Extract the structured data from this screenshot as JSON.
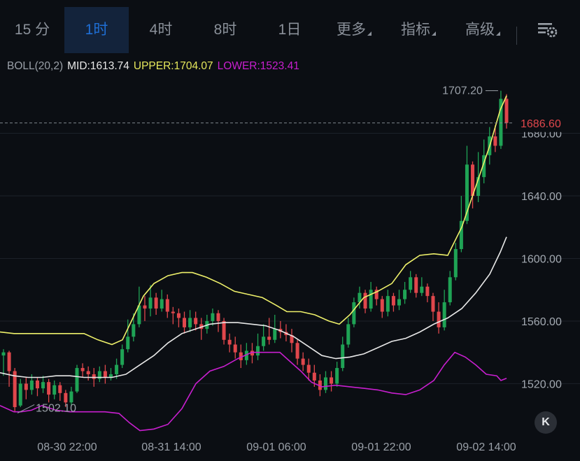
{
  "tabs": [
    {
      "label": "15 分",
      "active": false
    },
    {
      "label": "1时",
      "active": true
    },
    {
      "label": "4时",
      "active": false
    },
    {
      "label": "8时",
      "active": false
    },
    {
      "label": "1日",
      "active": false
    },
    {
      "label": "更多",
      "active": false,
      "dropdown": true
    },
    {
      "label": "指标",
      "active": false,
      "dropdown": true
    },
    {
      "label": "高级",
      "active": false,
      "dropdown": true
    }
  ],
  "settings_icon": "chart-settings-icon",
  "indicator": {
    "name": "BOLL(20,2)",
    "mid_label": "MID:",
    "mid_value": "1613.74",
    "upper_label": "UPPER:",
    "upper_value": "1704.07",
    "lower_label": "LOWER:",
    "lower_value": "1523.41"
  },
  "colors": {
    "up": "#1fa355",
    "down": "#e0474c",
    "mid": "#e8e8e8",
    "upper": "#eef06a",
    "lower": "#c81fcf",
    "active_tab": "#1f6fd6",
    "price_tag": "#e0474c"
  },
  "chart_data": {
    "type": "candlestick",
    "interval": "1h",
    "ylim": [
      1488,
      1716
    ],
    "y_ticks": [
      "1520.00",
      "1560.00",
      "1600.00",
      "1640.00",
      "1680.00"
    ],
    "x_ticks": [
      "08-30 22:00",
      "08-31 14:00",
      "09-01 06:00",
      "09-01 22:00",
      "09-02 14:00"
    ],
    "high_label": "1707.20",
    "low_label": "1502.10",
    "current_price": "1686.60",
    "candles": [
      [
        1538,
        1540,
        1542,
        1525
      ],
      [
        1540,
        1528,
        1541,
        1518
      ],
      [
        1528,
        1505,
        1530,
        1502.1
      ],
      [
        1506,
        1520,
        1523,
        1505
      ],
      [
        1520,
        1516,
        1524,
        1510
      ],
      [
        1516,
        1522,
        1526,
        1513
      ],
      [
        1522,
        1517,
        1524,
        1512
      ],
      [
        1517,
        1521,
        1525,
        1514
      ],
      [
        1521,
        1513,
        1523,
        1508
      ],
      [
        1513,
        1519,
        1522,
        1510
      ],
      [
        1519,
        1514,
        1521,
        1509
      ],
      [
        1514,
        1508,
        1516,
        1505
      ],
      [
        1508,
        1515,
        1518,
        1506
      ],
      [
        1515,
        1530,
        1532,
        1514
      ],
      [
        1530,
        1528,
        1533,
        1524
      ],
      [
        1528,
        1526,
        1531,
        1522
      ],
      [
        1526,
        1523,
        1530,
        1518
      ],
      [
        1523,
        1528,
        1531,
        1521
      ],
      [
        1528,
        1524,
        1532,
        1520
      ],
      [
        1524,
        1526,
        1530,
        1522
      ],
      [
        1526,
        1532,
        1536,
        1523
      ],
      [
        1532,
        1542,
        1545,
        1530
      ],
      [
        1542,
        1550,
        1561,
        1540
      ],
      [
        1550,
        1558,
        1565,
        1547
      ],
      [
        1558,
        1570,
        1582,
        1556
      ],
      [
        1570,
        1568,
        1576,
        1560
      ],
      [
        1568,
        1575,
        1583,
        1563
      ],
      [
        1575,
        1568,
        1578,
        1564
      ],
      [
        1568,
        1574,
        1580,
        1566
      ],
      [
        1574,
        1566,
        1577,
        1562
      ],
      [
        1566,
        1565,
        1569,
        1558
      ],
      [
        1565,
        1562,
        1568,
        1556
      ],
      [
        1562,
        1556,
        1566,
        1552
      ],
      [
        1556,
        1562,
        1567,
        1553
      ],
      [
        1562,
        1558,
        1566,
        1554
      ],
      [
        1558,
        1555,
        1562,
        1548
      ],
      [
        1555,
        1560,
        1564,
        1552
      ],
      [
        1560,
        1565,
        1568,
        1557
      ],
      [
        1565,
        1560,
        1567,
        1553
      ],
      [
        1560,
        1548,
        1562,
        1545
      ],
      [
        1548,
        1545,
        1552,
        1540
      ],
      [
        1545,
        1540,
        1550,
        1536
      ],
      [
        1540,
        1535,
        1545,
        1530
      ],
      [
        1535,
        1541,
        1546,
        1532
      ],
      [
        1541,
        1538,
        1546,
        1533
      ],
      [
        1538,
        1544,
        1552,
        1535
      ],
      [
        1544,
        1550,
        1558,
        1541
      ],
      [
        1550,
        1548,
        1562,
        1545
      ],
      [
        1548,
        1555,
        1564,
        1546
      ],
      [
        1555,
        1553,
        1560,
        1549
      ],
      [
        1553,
        1551,
        1558,
        1547
      ],
      [
        1551,
        1546,
        1555,
        1540
      ],
      [
        1546,
        1536,
        1548,
        1532
      ],
      [
        1536,
        1532,
        1540,
        1528
      ],
      [
        1532,
        1527,
        1536,
        1522
      ],
      [
        1527,
        1522,
        1532,
        1518
      ],
      [
        1522,
        1516,
        1526,
        1512
      ],
      [
        1516,
        1524,
        1528,
        1514
      ],
      [
        1524,
        1520,
        1528,
        1515
      ],
      [
        1520,
        1530,
        1534,
        1518
      ],
      [
        1530,
        1545,
        1550,
        1528
      ],
      [
        1545,
        1558,
        1562,
        1543
      ],
      [
        1558,
        1572,
        1575,
        1556
      ],
      [
        1572,
        1578,
        1582,
        1568
      ],
      [
        1578,
        1568,
        1580,
        1565
      ],
      [
        1568,
        1580,
        1585,
        1566
      ],
      [
        1580,
        1574,
        1582,
        1570
      ],
      [
        1574,
        1566,
        1576,
        1562
      ],
      [
        1566,
        1576,
        1580,
        1563
      ],
      [
        1576,
        1570,
        1578,
        1566
      ],
      [
        1570,
        1574,
        1580,
        1567
      ],
      [
        1574,
        1580,
        1585,
        1571
      ],
      [
        1580,
        1588,
        1592,
        1578
      ],
      [
        1588,
        1578,
        1590,
        1575
      ],
      [
        1578,
        1582,
        1588,
        1576
      ],
      [
        1582,
        1576,
        1584,
        1572
      ],
      [
        1576,
        1566,
        1578,
        1560
      ],
      [
        1566,
        1556,
        1572,
        1552
      ],
      [
        1556,
        1572,
        1580,
        1554
      ],
      [
        1572,
        1588,
        1592,
        1570
      ],
      [
        1588,
        1606,
        1610,
        1586
      ],
      [
        1606,
        1624,
        1640,
        1604
      ],
      [
        1624,
        1660,
        1672,
        1622
      ],
      [
        1660,
        1640,
        1662,
        1632
      ],
      [
        1640,
        1652,
        1668,
        1636
      ],
      [
        1652,
        1666,
        1676,
        1648
      ],
      [
        1666,
        1678,
        1684,
        1660
      ],
      [
        1678,
        1672,
        1685,
        1668
      ],
      [
        1672,
        1702,
        1707.2,
        1670
      ],
      [
        1702,
        1686.6,
        1705,
        1683
      ]
    ],
    "boll_upper": [
      [
        0,
        1553
      ],
      [
        20,
        1552
      ],
      [
        40,
        1552
      ],
      [
        60,
        1552
      ],
      [
        80,
        1552
      ],
      [
        100,
        1552
      ],
      [
        120,
        1552
      ],
      [
        140,
        1548
      ],
      [
        160,
        1545
      ],
      [
        175,
        1548
      ],
      [
        190,
        1562
      ],
      [
        205,
        1576
      ],
      [
        220,
        1584
      ],
      [
        240,
        1589
      ],
      [
        260,
        1591
      ],
      [
        275,
        1591
      ],
      [
        295,
        1588
      ],
      [
        315,
        1584
      ],
      [
        335,
        1579
      ],
      [
        355,
        1577
      ],
      [
        375,
        1575
      ],
      [
        395,
        1570
      ],
      [
        410,
        1566
      ],
      [
        430,
        1566
      ],
      [
        450,
        1564
      ],
      [
        470,
        1560
      ],
      [
        485,
        1558
      ],
      [
        500,
        1564
      ],
      [
        520,
        1575
      ],
      [
        540,
        1579
      ],
      [
        560,
        1584
      ],
      [
        580,
        1596
      ],
      [
        600,
        1602
      ],
      [
        620,
        1603
      ],
      [
        640,
        1602
      ],
      [
        660,
        1620
      ],
      [
        680,
        1646
      ],
      [
        700,
        1672
      ],
      [
        715,
        1695
      ],
      [
        724,
        1704
      ]
    ],
    "boll_mid": [
      [
        0,
        1527
      ],
      [
        20,
        1525
      ],
      [
        40,
        1524
      ],
      [
        60,
        1524
      ],
      [
        80,
        1525
      ],
      [
        100,
        1525
      ],
      [
        120,
        1524
      ],
      [
        140,
        1524
      ],
      [
        160,
        1524
      ],
      [
        180,
        1526
      ],
      [
        200,
        1532
      ],
      [
        220,
        1538
      ],
      [
        240,
        1546
      ],
      [
        260,
        1552
      ],
      [
        280,
        1555
      ],
      [
        300,
        1558
      ],
      [
        320,
        1559
      ],
      [
        340,
        1559
      ],
      [
        360,
        1558
      ],
      [
        380,
        1557
      ],
      [
        400,
        1554
      ],
      [
        420,
        1550
      ],
      [
        440,
        1544
      ],
      [
        460,
        1538
      ],
      [
        480,
        1536
      ],
      [
        500,
        1537
      ],
      [
        520,
        1539
      ],
      [
        540,
        1543
      ],
      [
        560,
        1547
      ],
      [
        580,
        1549
      ],
      [
        600,
        1553
      ],
      [
        620,
        1558
      ],
      [
        640,
        1562
      ],
      [
        660,
        1568
      ],
      [
        680,
        1578
      ],
      [
        700,
        1590
      ],
      [
        715,
        1604
      ],
      [
        724,
        1613.74
      ]
    ],
    "boll_lower": [
      [
        0,
        1506
      ],
      [
        20,
        1502
      ],
      [
        30,
        1502
      ],
      [
        45,
        1503
      ],
      [
        60,
        1506
      ],
      [
        80,
        1503
      ],
      [
        100,
        1502
      ],
      [
        120,
        1502
      ],
      [
        150,
        1502
      ],
      [
        170,
        1501
      ],
      [
        185,
        1495
      ],
      [
        200,
        1490
      ],
      [
        220,
        1491
      ],
      [
        240,
        1494
      ],
      [
        260,
        1504
      ],
      [
        280,
        1520
      ],
      [
        300,
        1528
      ],
      [
        320,
        1531
      ],
      [
        340,
        1536
      ],
      [
        360,
        1540
      ],
      [
        380,
        1540
      ],
      [
        400,
        1540
      ],
      [
        415,
        1534
      ],
      [
        430,
        1528
      ],
      [
        445,
        1521
      ],
      [
        460,
        1518
      ],
      [
        480,
        1519
      ],
      [
        500,
        1518
      ],
      [
        520,
        1517
      ],
      [
        540,
        1516
      ],
      [
        560,
        1514
      ],
      [
        580,
        1513
      ],
      [
        600,
        1516
      ],
      [
        620,
        1522
      ],
      [
        635,
        1532
      ],
      [
        650,
        1540
      ],
      [
        665,
        1537
      ],
      [
        680,
        1532
      ],
      [
        695,
        1526
      ],
      [
        710,
        1525
      ],
      [
        716,
        1522
      ],
      [
        724,
        1523.41
      ]
    ]
  },
  "back_button_label": "K"
}
